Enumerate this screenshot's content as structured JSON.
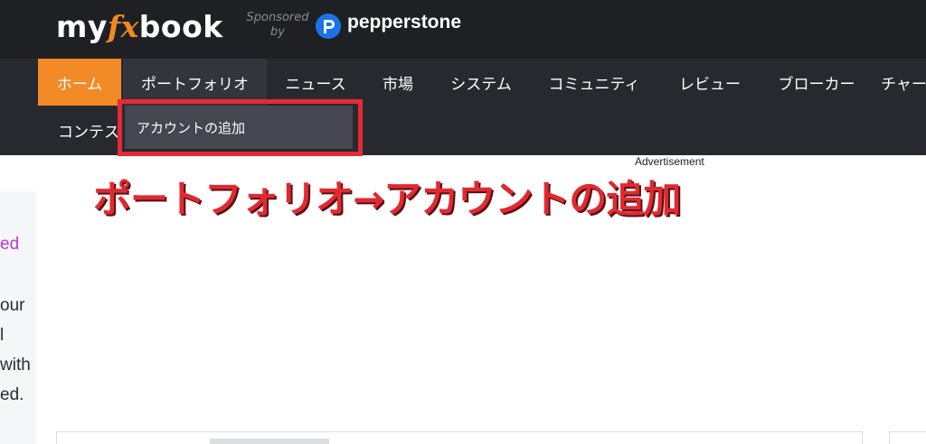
{
  "header": {
    "logo": {
      "part1": "my",
      "part2": "fx",
      "part3": "book"
    },
    "sponsored": {
      "line1": "Sponsored",
      "line2": "by"
    },
    "sponsor_name": "pepperstone",
    "sponsor_icon": "pepperstone-logo-icon"
  },
  "nav": {
    "items": [
      {
        "label": "ホーム",
        "active": true
      },
      {
        "label": "ポートフォリオ",
        "hovered": true
      },
      {
        "label": "ニュース"
      },
      {
        "label": "市場"
      },
      {
        "label": "システム"
      },
      {
        "label": "コミュニティ"
      },
      {
        "label": "レビュー"
      },
      {
        "label": "ブローカー"
      },
      {
        "label": "チャー"
      }
    ],
    "row2_label": "コンテス",
    "dropdown_item": "アカウントの追加"
  },
  "content": {
    "ad_label": "Advertisement",
    "annotation": "ポートフォリオ→アカウントの追加",
    "left_fragments": [
      "ed",
      "our",
      "l",
      "with",
      "ed."
    ]
  },
  "colors": {
    "brand_orange": "#f28a26",
    "highlight_red": "#e52a36",
    "topbar": "#1f2023",
    "navbar": "#27292f"
  }
}
